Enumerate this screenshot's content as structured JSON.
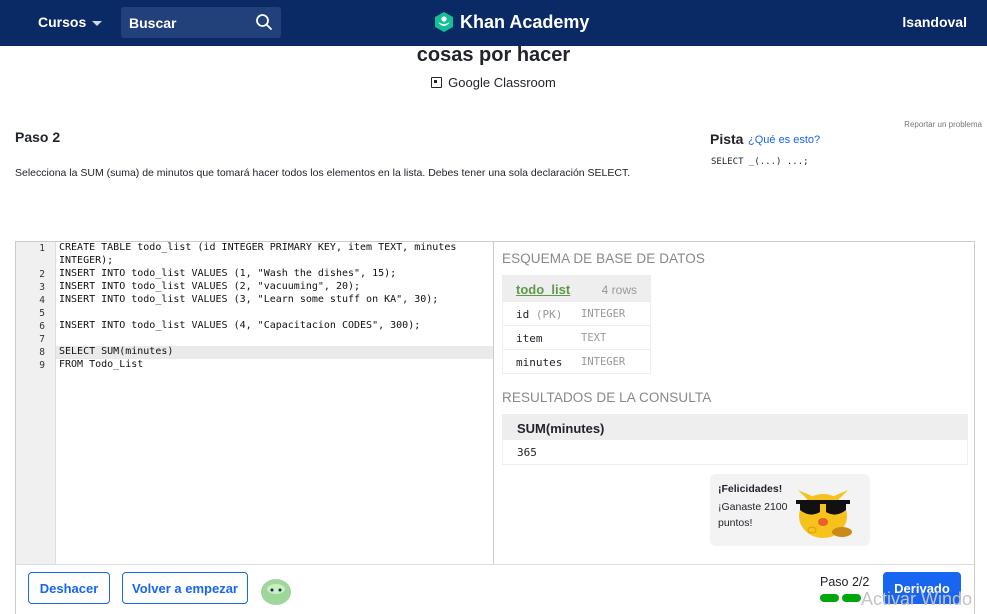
{
  "nav": {
    "courses": "Cursos",
    "search_placeholder": "Buscar",
    "brand": "Khan Academy",
    "user": "lsandoval"
  },
  "header": {
    "title": "cosas por hacer",
    "classroom": "Google Classroom",
    "report": "Reportar un problema"
  },
  "step": {
    "title": "Paso 2",
    "text": "Selecciona la SUM (suma) de minutos que tomará hacer todos los elementos en la lista. Debes tener una sola declaración SELECT."
  },
  "hint": {
    "title": "Pista",
    "link": "¿Qué es esto?",
    "code": "SELECT _(...) ...;"
  },
  "editor": {
    "line_numbers": [
      "1",
      "2",
      "3",
      "4",
      "5",
      "6",
      "7",
      "8",
      "9"
    ],
    "lines": [
      "CREATE TABLE todo_list (id INTEGER PRIMARY KEY, item TEXT, minutes",
      "INTEGER);",
      "INSERT INTO todo_list VALUES (1, \"Wash the dishes\", 15);",
      "INSERT INTO todo_list VALUES (2, \"vacuuming\", 20);",
      "INSERT INTO todo_list VALUES (3, \"Learn some stuff on KA\", 30);",
      "",
      "INSERT INTO todo_list VALUES (4, \"Capacitacion CODES\", 300);",
      "",
      "SELECT SUM(minutes)",
      "FROM Todo_List"
    ]
  },
  "schema": {
    "heading": "ESQUEMA DE BASE DE DATOS",
    "table_name": "todo_list",
    "row_count": "4 rows",
    "columns": [
      {
        "name": "id",
        "pk": "(PK)",
        "type": "INTEGER"
      },
      {
        "name": "item",
        "pk": "",
        "type": "TEXT"
      },
      {
        "name": "minutes",
        "pk": "",
        "type": "INTEGER"
      }
    ]
  },
  "results": {
    "heading": "RESULTADOS DE LA CONSULTA",
    "column": "SUM(minutes)",
    "value": "365"
  },
  "congrats": {
    "title": "¡Felicidades!",
    "message": "¡Ganaste 2100 puntos!"
  },
  "footer": {
    "undo": "Deshacer",
    "restart": "Volver a empezar",
    "step_count": "Paso 2/2",
    "next": "Derivado"
  },
  "watermark": "Activar Windo"
}
